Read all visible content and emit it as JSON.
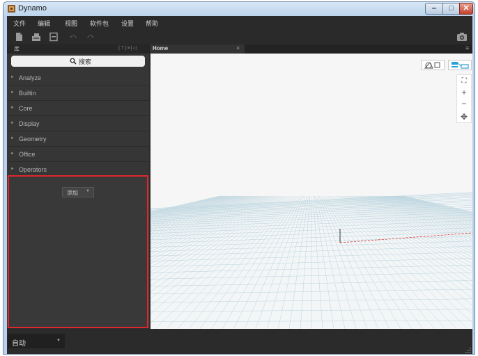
{
  "window": {
    "title": "Dynamo"
  },
  "menu": [
    "文件",
    "编辑",
    "视图",
    "软件包",
    "设置",
    "帮助"
  ],
  "toolbar": {
    "icons": [
      "new-file-icon",
      "open-icon",
      "save-icon",
      "undo-icon",
      "redo-icon",
      "screenshot-icon"
    ]
  },
  "library": {
    "title": "库",
    "controls": "|⊤|≡|◁",
    "search_label": "搜索",
    "items": [
      {
        "label": "Analyze"
      },
      {
        "label": "Builtin"
      },
      {
        "label": "Core"
      },
      {
        "label": "Display"
      },
      {
        "label": "Geometry"
      },
      {
        "label": "Office"
      },
      {
        "label": "Operators"
      }
    ],
    "addon": {
      "add_label": "添加",
      "highlight_color": "#e0282c"
    }
  },
  "tabs": [
    {
      "label": "Home",
      "close": "×"
    }
  ],
  "tab_menu": "≡",
  "viewport": {
    "nav": {
      "fit": "⛶",
      "zoom_in": "+",
      "zoom_out": "−",
      "pan": "✥"
    }
  },
  "status": {
    "run_mode": "自动"
  },
  "colors": {
    "accent_blue": "#2a9fd8",
    "axis_red": "#e03030",
    "grid": "#b9d3dd"
  }
}
